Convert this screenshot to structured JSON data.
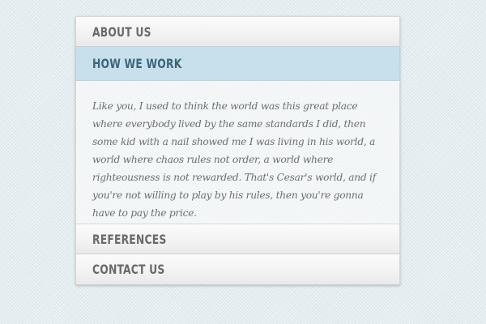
{
  "accordion": {
    "sections": [
      {
        "label": "ABOUT US"
      },
      {
        "label": "HOW WE WORK"
      },
      {
        "label": "REFERENCES"
      },
      {
        "label": "CONTACT US"
      }
    ],
    "active_index": 1,
    "active_content": "Like you, I used to think the world was this great place where everybody lived by the same standards I did, then some kid with a nail showed me I was living in his world, a world where chaos rules not order, a world where righteousness is not rewarded. That's Cesar's world, and if you're not willing to play by his rules, then you're gonna have to pay the price."
  },
  "colors": {
    "page_background": "#e6eef1",
    "active_header_background": "#c8e0ec",
    "active_header_text": "#3c6579",
    "header_text": "#6a6a6a",
    "panel_text": "#6b6f72"
  }
}
